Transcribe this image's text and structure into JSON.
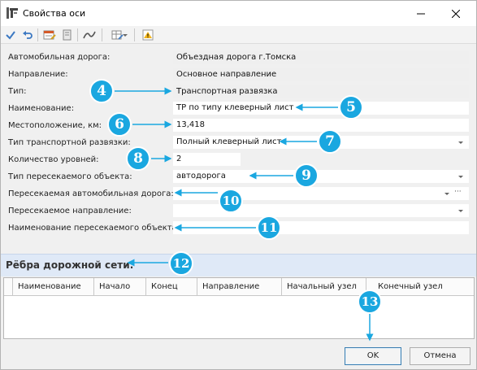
{
  "window": {
    "title": "Свойства оси"
  },
  "form": {
    "fields": [
      {
        "label": "Автомобильная дорога:",
        "value": "Объездная дорога г.Томска"
      },
      {
        "label": "Направление:",
        "value": "Основное направление"
      },
      {
        "label": "Тип:",
        "value": "Транспортная развязка"
      },
      {
        "label": "Наименование:",
        "value": "ТР по типу клеверный лист"
      },
      {
        "label": "Местоположение, км:",
        "value": "13,418"
      },
      {
        "label": "Тип транспортной развязки:",
        "value": "Полный клеверный лист"
      },
      {
        "label": "Количество уровней:",
        "value": "2"
      },
      {
        "label": "Тип пересекаемого объекта:",
        "value": "автодорога"
      },
      {
        "label": "Пересекаемая автомобильная дорога:",
        "value": ""
      },
      {
        "label": "Пересекаемое направление:",
        "value": ""
      },
      {
        "label": "Наименование пересекаемого объекта:",
        "value": ""
      }
    ],
    "ellipsis": "···"
  },
  "section": {
    "title": "Рёбра дорожной сети:"
  },
  "grid": {
    "columns": [
      "Наименование",
      "Начало",
      "Конец",
      "Направление",
      "Начальный узел",
      "Конечный узел"
    ]
  },
  "buttons": {
    "ok": "OK",
    "cancel": "Отмена"
  },
  "callouts": [
    "4",
    "5",
    "6",
    "7",
    "8",
    "9",
    "10",
    "11",
    "12",
    "13"
  ],
  "colors": {
    "callout": "#1aa7e0",
    "section_bg": "#dfe9f7",
    "accent": "#3c7fb1"
  }
}
